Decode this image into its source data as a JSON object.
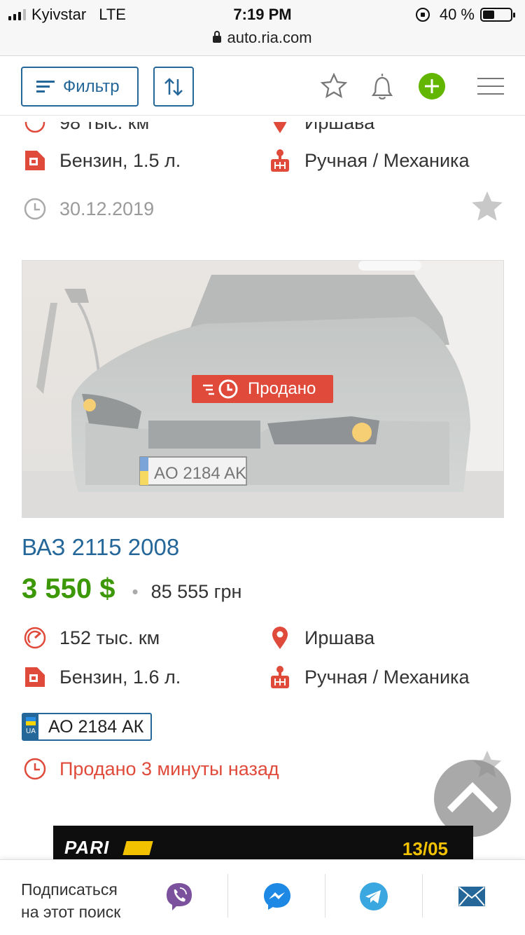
{
  "status_bar": {
    "carrier": "Kyivstar",
    "network": "LTE",
    "time": "7:19 PM",
    "battery": "40 %",
    "battery_level": 0.4
  },
  "browser": {
    "url": "auto.ria.com"
  },
  "toolbar": {
    "filter_label": "Фильтр"
  },
  "prev_listing": {
    "mileage": "98 тыс. км",
    "city": "Иршава",
    "fuel": "Бензин, 1.5 л.",
    "transmission": "Ручная / Механика",
    "date": "30.12.2019"
  },
  "listing": {
    "sold_badge": "Продано",
    "title": "ВАЗ 2115 2008",
    "price_usd": "3 550 $",
    "separator": "•",
    "price_uah": "85 555 грн",
    "mileage": "152 тыс. км",
    "city": "Иршава",
    "fuel": "Бензин, 1.6 л.",
    "transmission": "Ручная / Механика",
    "plate_country": "UA",
    "plate": "АО 2184 АК",
    "photo_plate": "AO 2184 AK",
    "sold_text": "Продано 3 минуты назад"
  },
  "banner": {
    "brand": "PARI",
    "date": "13/05"
  },
  "bottom_bar": {
    "subscribe_line1": "Подписаться",
    "subscribe_line2": "на этот поиск"
  },
  "colors": {
    "accent": "#256799",
    "price": "#3c9806",
    "sold": "#e04a3b",
    "add": "#62b600"
  }
}
